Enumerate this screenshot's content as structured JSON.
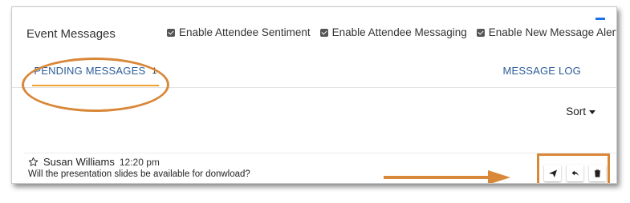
{
  "header": {
    "title": "Event Messages",
    "options": [
      {
        "label": "Enable Attendee Sentiment",
        "checked": true
      },
      {
        "label": "Enable Attendee Messaging",
        "checked": true
      },
      {
        "label": "Enable New Message Alert",
        "checked": true
      }
    ]
  },
  "tabs": {
    "pending_label": "PENDING MESSAGES",
    "pending_count": "1",
    "log_label": "MESSAGE LOG"
  },
  "toolbar": {
    "sort_label": "Sort"
  },
  "messages": [
    {
      "author": "Susan Williams",
      "time": "12:20 pm",
      "text": "Will the presentation slides be available for donwload?",
      "actions": [
        "send-icon",
        "reply-icon",
        "trash-icon"
      ]
    }
  ],
  "colors": {
    "accent_blue": "#2b5d9a",
    "highlight_orange": "#d9883a",
    "tab_underline": "#f0a030",
    "bar_blue": "#1a73e8"
  }
}
